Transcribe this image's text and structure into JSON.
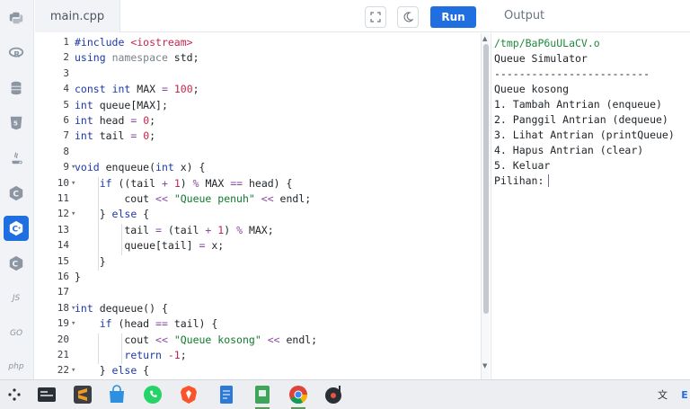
{
  "header": {
    "file_tab": "main.cpp",
    "run_label": "Run",
    "output_title": "Output"
  },
  "sidebar": {
    "items": [
      {
        "name": "python",
        "icon": "python-icon"
      },
      {
        "name": "r",
        "icon": "r-icon"
      },
      {
        "name": "sql",
        "icon": "database-icon"
      },
      {
        "name": "html",
        "icon": "html5-icon"
      },
      {
        "name": "java",
        "icon": "java-icon"
      },
      {
        "name": "c",
        "icon": "c-icon"
      },
      {
        "name": "cpp",
        "icon": "cpp-icon",
        "active": true
      },
      {
        "name": "csharp",
        "icon": "csharp-icon"
      },
      {
        "name": "javascript",
        "icon": "js-icon",
        "label": "JS"
      },
      {
        "name": "go",
        "icon": "go-icon",
        "label": "GO"
      },
      {
        "name": "php",
        "icon": "php-icon",
        "label": "php"
      }
    ]
  },
  "editor": {
    "lines": [
      {
        "n": "1",
        "text": "#include <iostream>"
      },
      {
        "n": "2",
        "text": "using namespace std;"
      },
      {
        "n": "3",
        "text": ""
      },
      {
        "n": "4",
        "text": "const int MAX = 100;"
      },
      {
        "n": "5",
        "text": "int queue[MAX];"
      },
      {
        "n": "6",
        "text": "int head = 0;"
      },
      {
        "n": "7",
        "text": "int tail = 0;"
      },
      {
        "n": "8",
        "text": ""
      },
      {
        "n": "9",
        "text": "void enqueue(int x) {"
      },
      {
        "n": "10",
        "text": "    if ((tail + 1) % MAX == head) {"
      },
      {
        "n": "11",
        "text": "        cout << \"Queue penuh\" << endl;"
      },
      {
        "n": "12",
        "text": "    } else {"
      },
      {
        "n": "13",
        "text": "        tail = (tail + 1) % MAX;"
      },
      {
        "n": "14",
        "text": "        queue[tail] = x;"
      },
      {
        "n": "15",
        "text": "    }"
      },
      {
        "n": "16",
        "text": "}"
      },
      {
        "n": "17",
        "text": ""
      },
      {
        "n": "18",
        "text": "int dequeue() {"
      },
      {
        "n": "19",
        "text": "    if (head == tail) {"
      },
      {
        "n": "20",
        "text": "        cout << \"Queue kosong\" << endl;"
      },
      {
        "n": "21",
        "text": "        return -1;"
      },
      {
        "n": "22",
        "text": "    } else {"
      }
    ]
  },
  "output": {
    "path": "/tmp/BaP6uULaCV.o",
    "lines": [
      "Queue Simulator",
      "-------------------------",
      "Queue kosong",
      "1. Tambah Antrian (enqueue)",
      "2. Panggil Antrian (dequeue)",
      "3. Lihat Antrian (printQueue)",
      "4. Hapus Antrian (clear)",
      "5. Keluar",
      "Pilihan: "
    ]
  },
  "taskbar": {
    "apps": [
      "apps-grid-icon",
      "terminal-icon",
      "sublime-text-icon",
      "store-icon",
      "whatsapp-icon",
      "brave-icon",
      "notes-icon",
      "evernote-icon",
      "chrome-icon",
      "music-player-icon"
    ],
    "tray_label": "E"
  },
  "colors": {
    "accent": "#1f6fe0",
    "string": "#0f7b2c",
    "keyword": "#1c3aa9",
    "number": "#c7254e"
  }
}
